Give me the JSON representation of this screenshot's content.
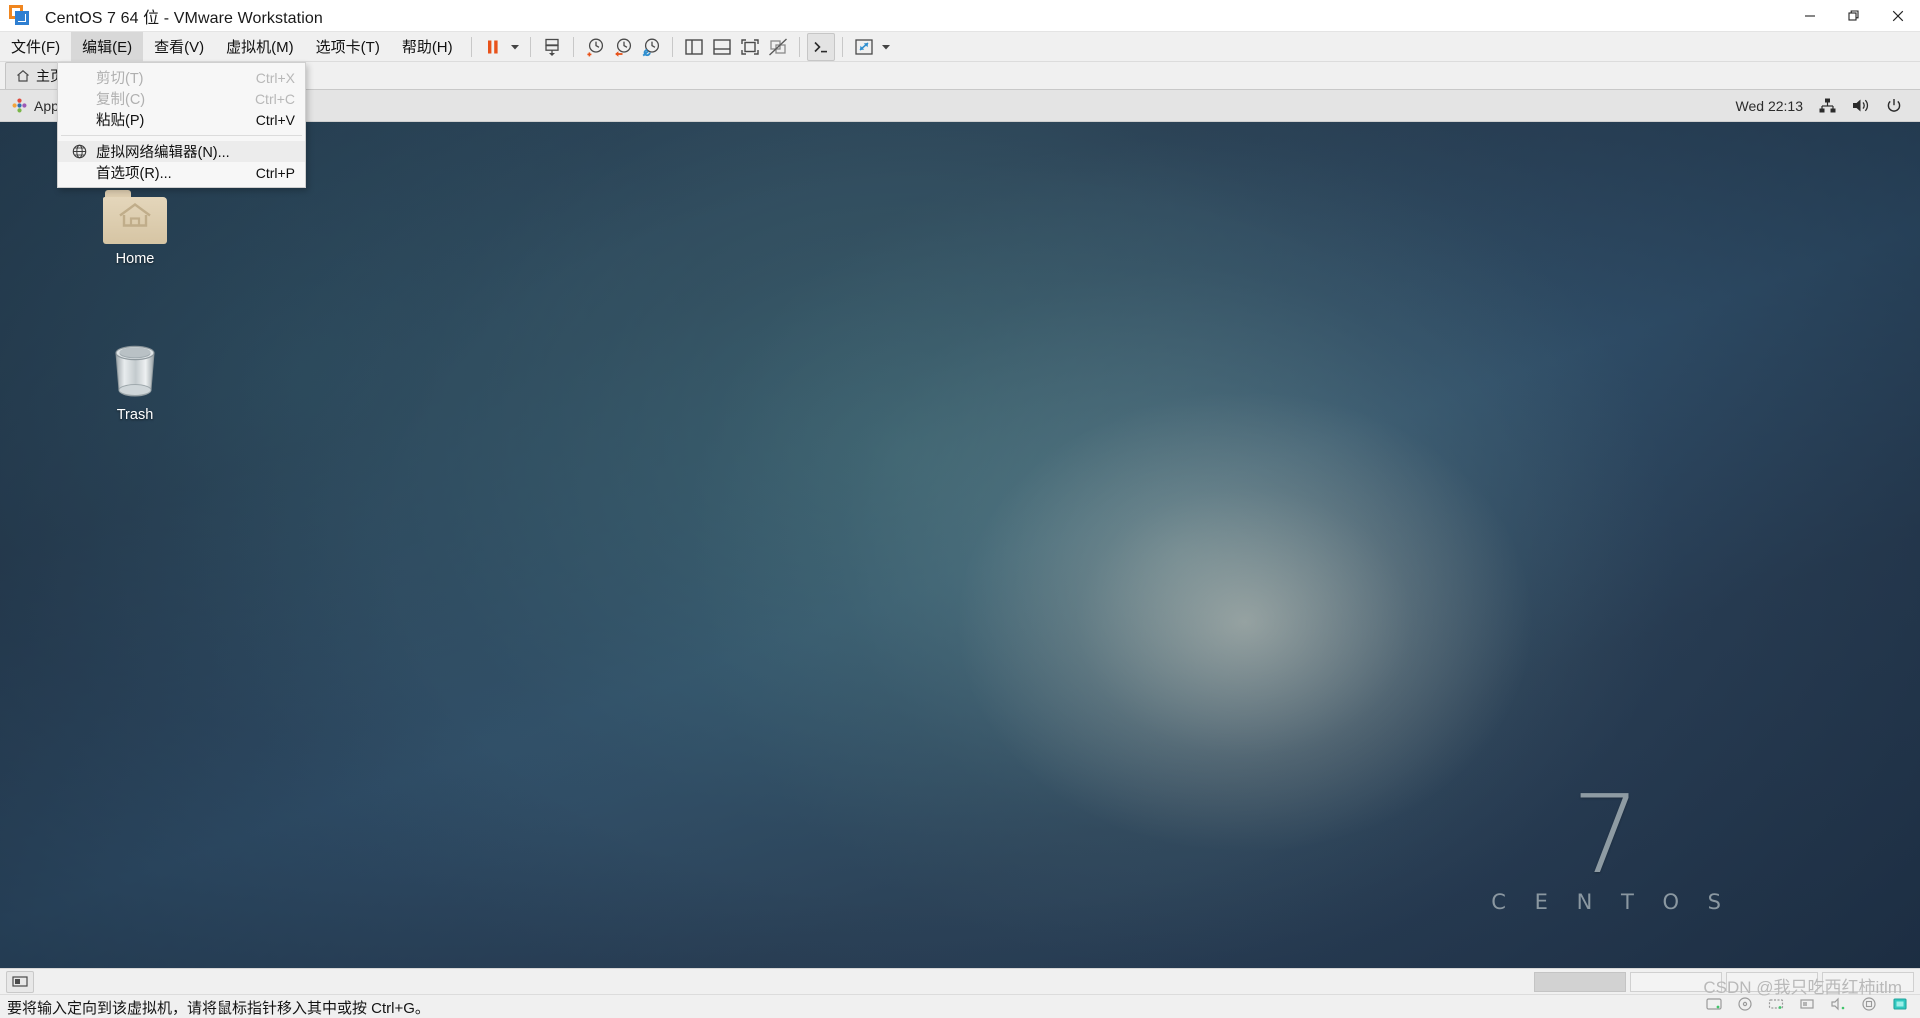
{
  "window": {
    "title": "CentOS 7 64 位 - VMware Workstation",
    "app_icon": "vmware-logo-icon",
    "controls": {
      "minimize": "minimize-icon",
      "restore": "restore-icon",
      "close": "close-icon"
    }
  },
  "menubar": {
    "items": [
      {
        "label": "文件(F)",
        "mnemonic": "F",
        "active": false,
        "name": "menu-file"
      },
      {
        "label": "编辑(E)",
        "mnemonic": "E",
        "active": true,
        "name": "menu-edit"
      },
      {
        "label": "查看(V)",
        "mnemonic": "V",
        "active": false,
        "name": "menu-view"
      },
      {
        "label": "虚拟机(M)",
        "mnemonic": "M",
        "active": false,
        "name": "menu-vm"
      },
      {
        "label": "选项卡(T)",
        "mnemonic": "T",
        "active": false,
        "name": "menu-tabs"
      },
      {
        "label": "帮助(H)",
        "mnemonic": "H",
        "active": false,
        "name": "menu-help"
      }
    ]
  },
  "toolbar": {
    "buttons": [
      {
        "name": "power-pause-button",
        "icon": "pause-icon"
      },
      {
        "name": "power-dropdown-button",
        "icon": "chevron-down-icon"
      },
      {
        "name": "manage-snapshot-button",
        "icon": "snapshot-icon"
      },
      {
        "name": "take-snapshot-button",
        "icon": "snapshot-add-icon"
      },
      {
        "name": "revert-snapshot-button",
        "icon": "snapshot-revert-icon"
      },
      {
        "name": "snapshot-manager-button",
        "icon": "snapshot-manager-icon"
      },
      {
        "name": "show-sidebar-button",
        "icon": "panel-left-icon"
      },
      {
        "name": "show-bottom-panel-button",
        "icon": "panel-bottom-icon"
      },
      {
        "name": "fullscreen-button",
        "icon": "fit-window-icon"
      },
      {
        "name": "unity-mode-button",
        "icon": "unity-off-icon"
      },
      {
        "name": "console-view-button",
        "icon": "terminal-icon"
      },
      {
        "name": "stretch-button",
        "icon": "expand-arrows-icon"
      },
      {
        "name": "stretch-dropdown-button",
        "icon": "chevron-down-icon"
      }
    ]
  },
  "edit_menu": {
    "open": true,
    "items": [
      {
        "label": "剪切(T)",
        "accel": "Ctrl+X",
        "disabled": true,
        "icon": null,
        "name": "menu-item-cut"
      },
      {
        "label": "复制(C)",
        "accel": "Ctrl+C",
        "disabled": true,
        "icon": null,
        "name": "menu-item-copy"
      },
      {
        "label": "粘贴(P)",
        "accel": "Ctrl+V",
        "disabled": false,
        "icon": null,
        "name": "menu-item-paste"
      },
      {
        "separator": true
      },
      {
        "label": "虚拟网络编辑器(N)...",
        "accel": "",
        "disabled": false,
        "icon": "globe-icon",
        "hover": true,
        "name": "menu-item-virtual-network-editor"
      },
      {
        "label": "首选项(R)...",
        "accel": "Ctrl+P",
        "disabled": false,
        "icon": null,
        "name": "menu-item-preferences"
      }
    ]
  },
  "vm_tabs": [
    {
      "label": "主页",
      "icon": "home-icon",
      "name": "vm-tab-home"
    }
  ],
  "guest": {
    "top_panel": {
      "applications_label": "Applications",
      "applications_icon": "applications-icon",
      "clock": "Wed 22:13",
      "tray": [
        {
          "name": "network-icon",
          "icon": "network-icon"
        },
        {
          "name": "volume-icon",
          "icon": "volume-icon"
        },
        {
          "name": "power-menu-icon",
          "icon": "power-icon"
        }
      ]
    },
    "desktop_icons": [
      {
        "label": "Home",
        "icon": "home-folder-icon",
        "name": "desktop-icon-home"
      },
      {
        "label": "Trash",
        "icon": "trash-icon",
        "name": "desktop-icon-trash"
      }
    ],
    "wallpaper": {
      "brand_number": "7",
      "brand_word": "C E N T O S"
    }
  },
  "statusbar": {
    "message": "要将输入定向到该虚拟机，请将鼠标指针移入其中或按 Ctrl+G。",
    "left_button": "usb-devices-icon",
    "vm_icons": [
      {
        "name": "hard-disk-icon"
      },
      {
        "name": "cd-dvd-icon"
      },
      {
        "name": "network-adapter-icon"
      },
      {
        "name": "usb-icon"
      },
      {
        "name": "sound-card-icon"
      },
      {
        "name": "printer-icon"
      },
      {
        "name": "display-icon"
      }
    ]
  },
  "watermark": "CSDN @我只吃西红柿itlm",
  "colors": {
    "accent_orange": "#f0861f",
    "accent_blue": "#2f7fd1",
    "titlebar_bg": "#ffffff",
    "chrome_bg": "#f0f0f0",
    "desktop_bg": "#2b3d4f",
    "menu_bg": "#f7f7f7",
    "disabled_text": "#b0b0b0"
  }
}
